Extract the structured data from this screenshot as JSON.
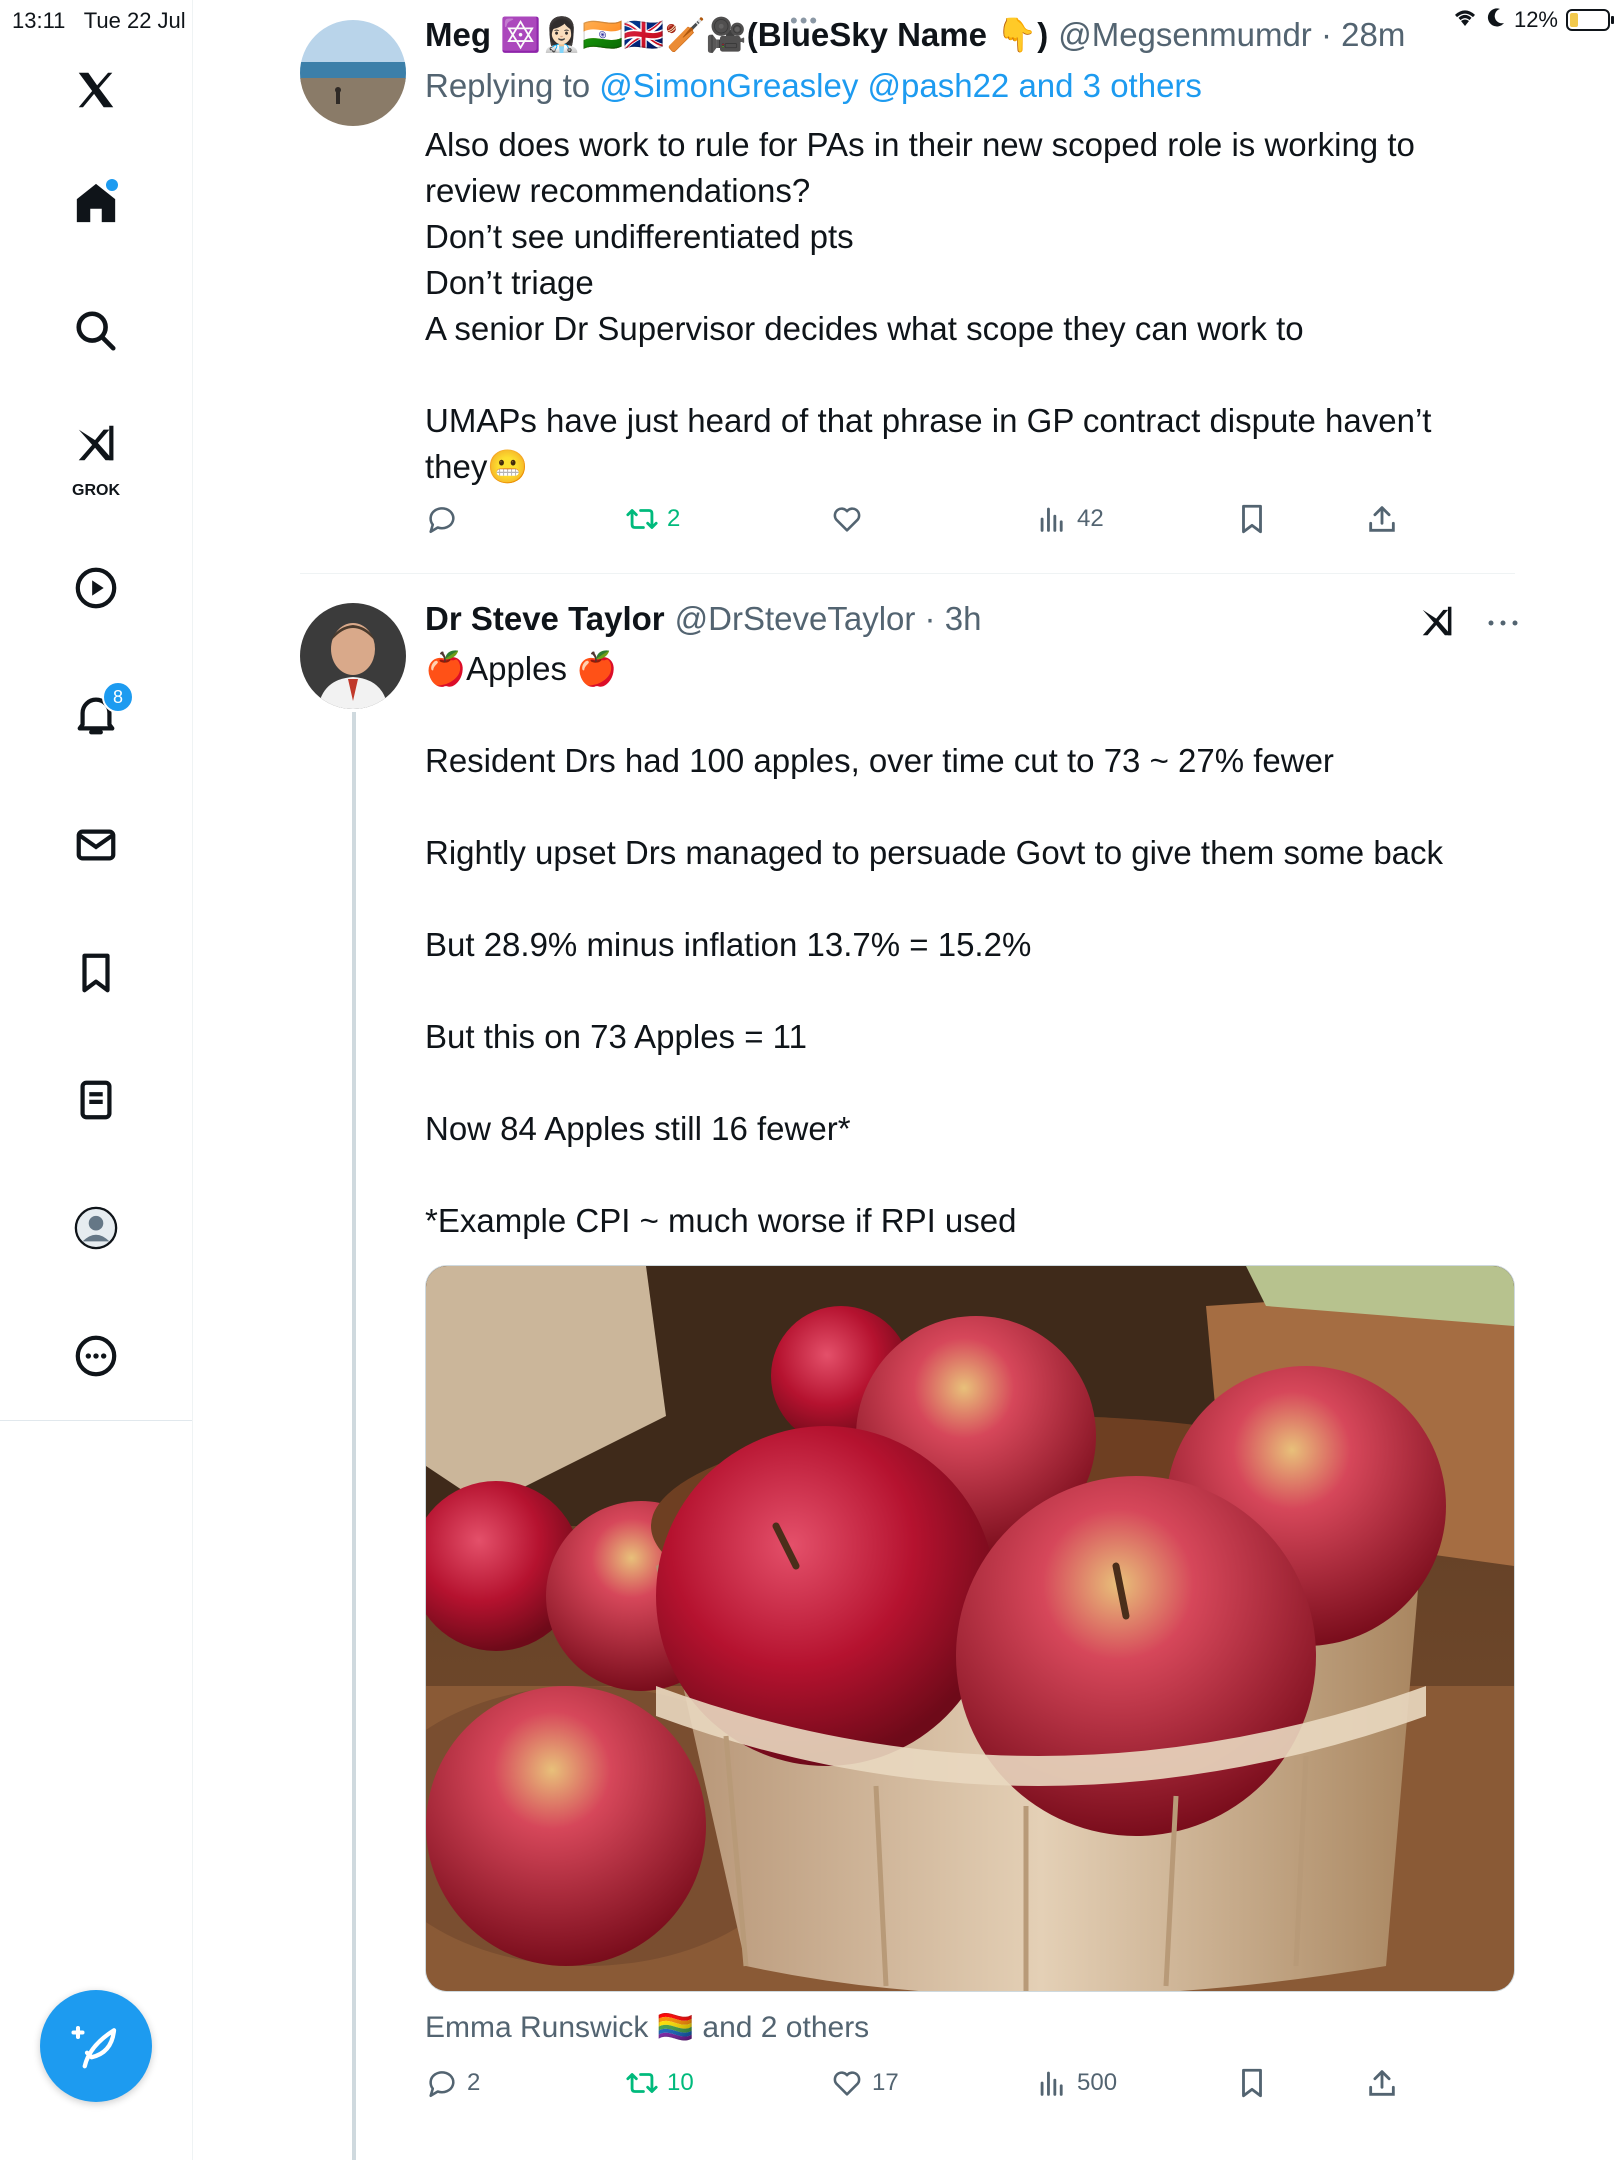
{
  "status_bar": {
    "time": "13:11",
    "date": "Tue 22 Jul",
    "battery": "12%"
  },
  "sidebar": {
    "grok_label": "GROK",
    "notifications_count": "8"
  },
  "tweet1": {
    "name": "Meg 🔯👩🏻‍⚕️🇮🇳🇬🇧🏏🎥(BlueSky Name 👇)",
    "handle": "@Megsenmumdr · 28m",
    "replying_prefix": "Replying to ",
    "replying_to": "@SimonGreasley @pash22 and 3 others",
    "lines": [
      "Also does work to rule for PAs in their new scoped role is working to",
      "review recommendations?",
      "Don’t see undifferentiated pts",
      "Don’t triage",
      "A senior Dr Supervisor decides what scope they can work to",
      "",
      "UMAPs have just heard of that phrase in GP contract dispute haven’t",
      "they😬"
    ],
    "retweets": "2",
    "views": "42"
  },
  "tweet2": {
    "name": "Dr Steve Taylor",
    "handle": "@DrSteveTaylor · 3h",
    "lines": [
      "🍎Apples 🍎",
      "",
      "Resident Drs had 100 apples, over time cut to 73 ~ 27% fewer",
      "",
      "Rightly upset Drs managed to persuade Govt to give them some back",
      "",
      "But 28.9% minus inflation 13.7% = 15.2%",
      "",
      "But this on 73 Apples = 11",
      "",
      "Now 84 Apples still 16 fewer*",
      "",
      "*Example CPI ~ much worse if RPI used"
    ],
    "tagged": "Emma Runswick 🏳️‍🌈 and 2 others",
    "replies": "2",
    "retweets": "10",
    "likes": "17",
    "views": "500"
  },
  "colors": {
    "accent": "#1d9bf0",
    "retweet": "#00ba7c",
    "muted": "#536471"
  }
}
